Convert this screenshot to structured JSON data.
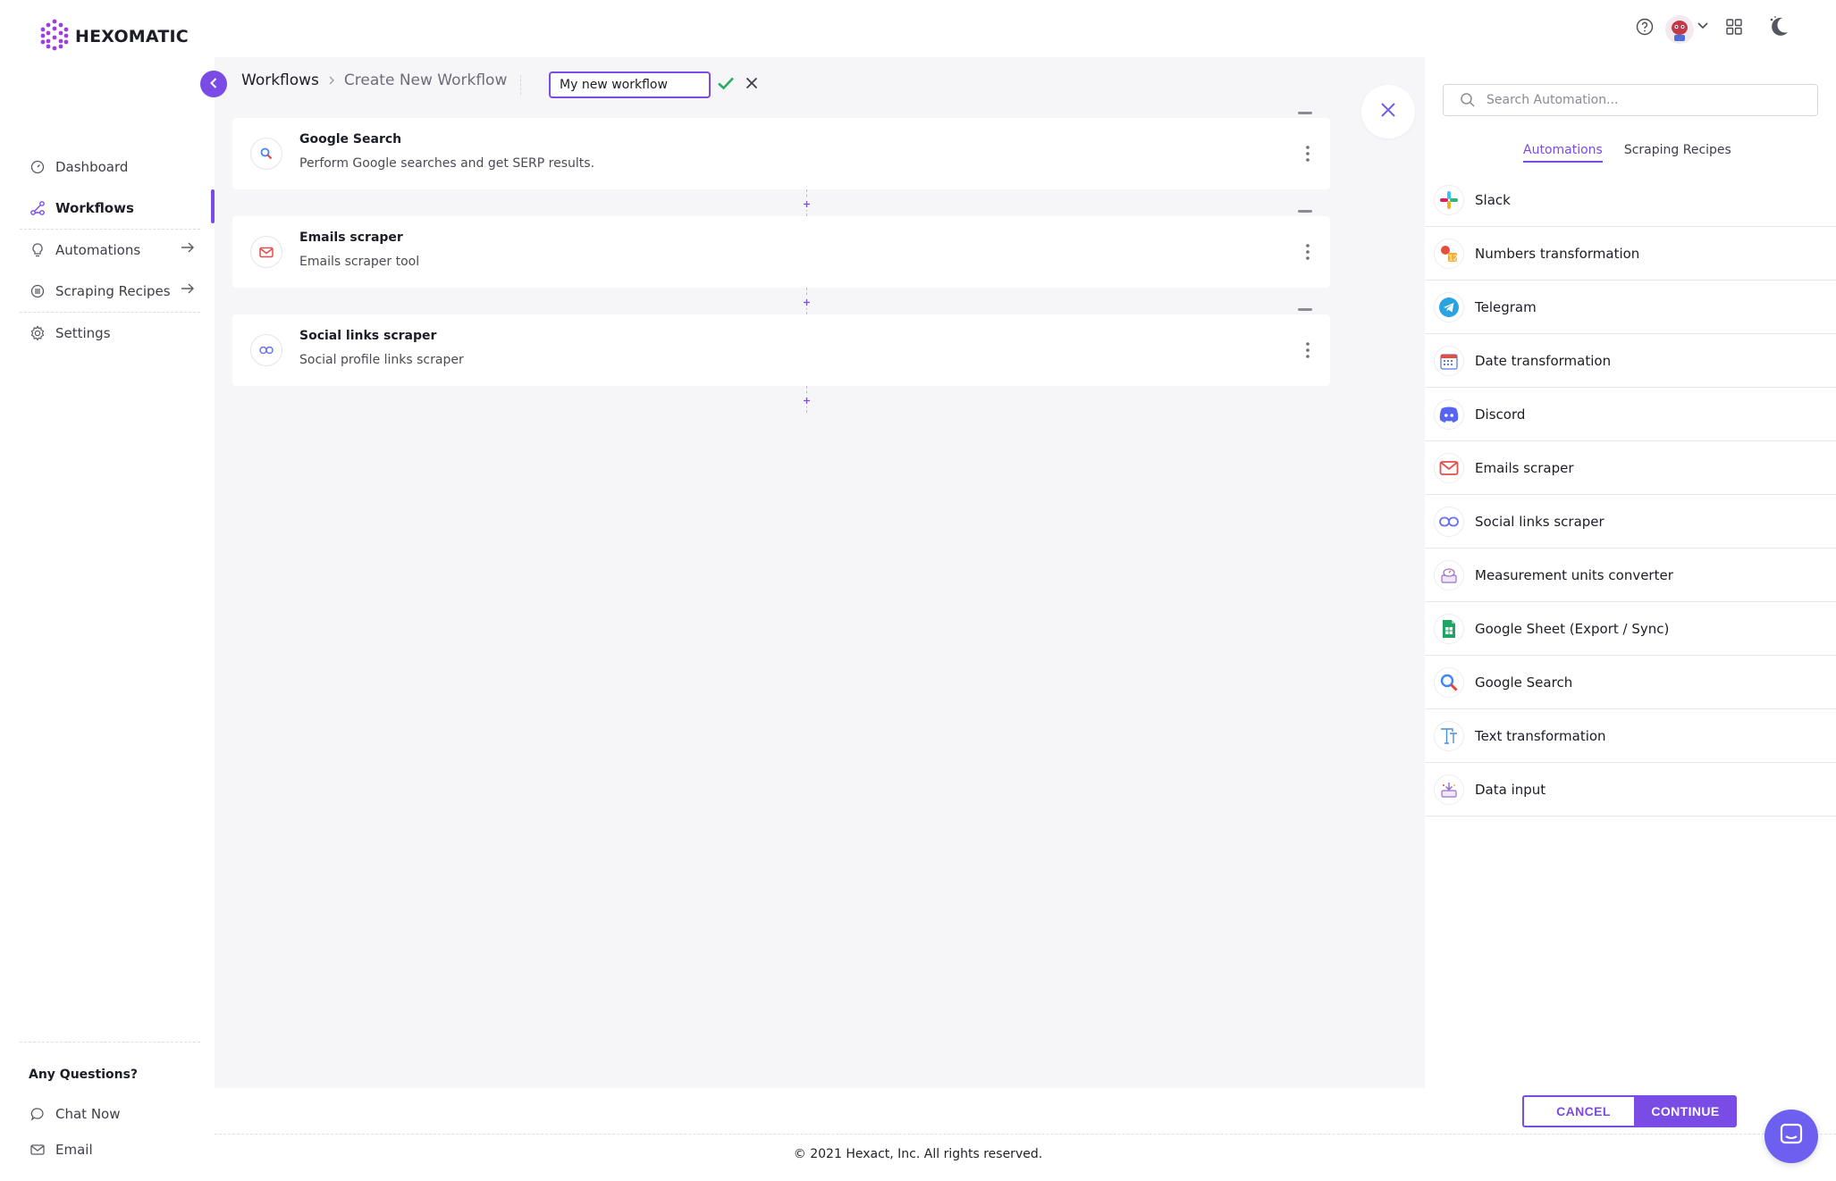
{
  "app": {
    "brand": "HEXOMATIC"
  },
  "sidebar": {
    "items": [
      {
        "label": "Dashboard",
        "icon": "dashboard-icon"
      },
      {
        "label": "Workflows",
        "icon": "workflow-icon",
        "active": true
      },
      {
        "label": "Automations",
        "icon": "bulb-icon",
        "has_arrow": true
      },
      {
        "label": "Scraping Recipes",
        "icon": "recipe-icon",
        "has_arrow": true
      },
      {
        "label": "Settings",
        "icon": "gear-icon"
      }
    ],
    "help_title": "Any Questions?",
    "help_items": [
      {
        "label": "Chat Now",
        "icon": "chat-icon"
      },
      {
        "label": "Email",
        "icon": "mail-icon"
      }
    ]
  },
  "header": {
    "breadcrumb": [
      "Workflows",
      "Create New Workflow"
    ],
    "workflow_name": "My new workflow"
  },
  "steps": [
    {
      "title": "Google Search",
      "description": "Perform Google searches and get SERP results.",
      "icon": "search-icon"
    },
    {
      "title": "Emails scraper",
      "description": "Emails scraper tool",
      "icon": "mail-icon"
    },
    {
      "title": "Social links scraper",
      "description": "Social profile links scraper",
      "icon": "link-icon"
    }
  ],
  "panel": {
    "search_placeholder": "Search Automation...",
    "tabs": [
      "Automations",
      "Scraping Recipes"
    ],
    "active_tab": 0,
    "automations": [
      {
        "label": "Slack",
        "icon": "slack-icon"
      },
      {
        "label": "Numbers transformation",
        "icon": "numbers-icon"
      },
      {
        "label": "Telegram",
        "icon": "telegram-icon"
      },
      {
        "label": "Date transformation",
        "icon": "calendar-icon"
      },
      {
        "label": "Discord",
        "icon": "discord-icon"
      },
      {
        "label": "Emails scraper",
        "icon": "mail-icon"
      },
      {
        "label": "Social links scraper",
        "icon": "link-icon"
      },
      {
        "label": "Measurement units converter",
        "icon": "scale-icon"
      },
      {
        "label": "Google Sheet (Export / Sync)",
        "icon": "sheet-icon"
      },
      {
        "label": "Google Search",
        "icon": "search-icon"
      },
      {
        "label": "Text transformation",
        "icon": "text-icon"
      },
      {
        "label": "Data input",
        "icon": "data-input-icon"
      }
    ]
  },
  "footer": {
    "cancel_label": "CANCEL",
    "continue_label": "CONTINUE",
    "copyright": "© 2021 Hexact, Inc. All rights reserved."
  },
  "colors": {
    "accent": "#7b4be6",
    "canvas_bg": "#f6f6f9",
    "confirm_green": "#27ae60",
    "chat_bubble": "#6d5ff0"
  }
}
